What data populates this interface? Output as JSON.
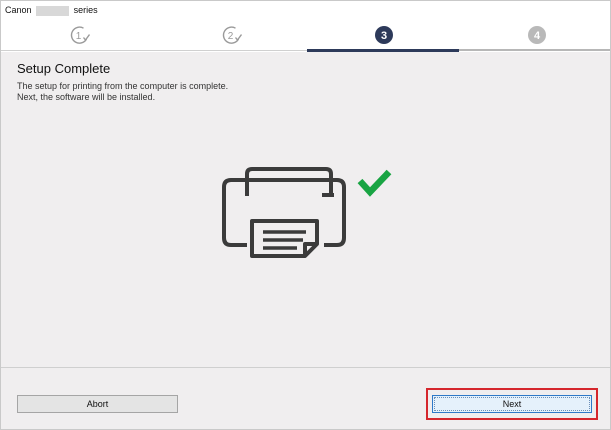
{
  "window": {
    "title_prefix": "Canon",
    "title_suffix": "series"
  },
  "steps": [
    {
      "number": "1",
      "state": "done"
    },
    {
      "number": "2",
      "state": "done"
    },
    {
      "number": "3",
      "state": "active"
    },
    {
      "number": "4",
      "state": "upcoming"
    }
  ],
  "main": {
    "heading": "Setup Complete",
    "line1": "The setup for printing from the computer is complete.",
    "line2": "Next, the software will be installed.",
    "illustration_icon": "printer-icon",
    "status_icon": "check-mark-icon"
  },
  "buttons": {
    "abort_label": "Abort",
    "next_label": "Next"
  },
  "colors": {
    "active_step": "#2d3a5a",
    "check_green": "#19a443",
    "highlight_red": "#d5262c",
    "default_button_border": "#2f79c8"
  }
}
